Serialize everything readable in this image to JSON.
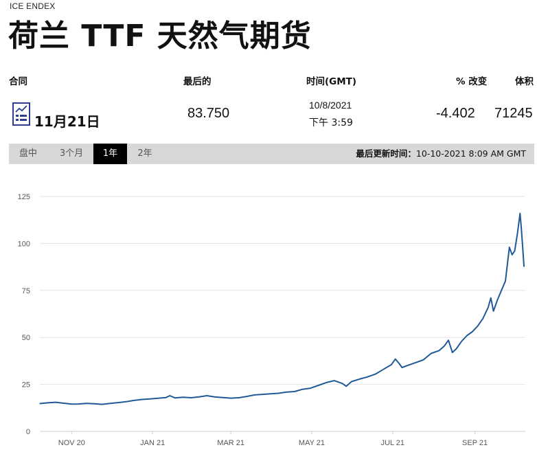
{
  "header": {
    "exchange": "ICE ENDEX",
    "title": "荷兰 TTF 天然气期货"
  },
  "quote_table": {
    "col_contract": "合同",
    "col_last": "最后的",
    "col_time": "时间(GMT)",
    "col_change": "% 改变",
    "col_volume": "体积",
    "contract_icon": "document-chart-icon",
    "contract": "11月21日",
    "last": "83.750",
    "date": "10/8/2021",
    "time": "下午 3:59",
    "change": "-4.402",
    "volume": "71245"
  },
  "tabs": [
    {
      "label": "盘中",
      "active": false
    },
    {
      "label": "3个月",
      "active": false
    },
    {
      "label": "1年",
      "active": true
    },
    {
      "label": "2年",
      "active": false
    }
  ],
  "last_updated_label": "最后更新时间：",
  "last_updated_value": "10-10-2021 8:09 AM GMT",
  "colors": {
    "line": "#1f5a96",
    "grid": "#e3e3e3",
    "tabbar": "#d8d8d8",
    "active_tab": "#000000"
  },
  "chart_data": {
    "type": "line",
    "ylim": [
      0,
      125
    ],
    "y_ticks": [
      0,
      25,
      50,
      75,
      100,
      125
    ],
    "x_tick_labels": [
      "NOV 20",
      "JAN 21",
      "MAR 21",
      "MAY 21",
      "JUL 21",
      "SEP 21"
    ],
    "x_tick_dates": [
      "2020-11-01",
      "2021-01-01",
      "2021-03-01",
      "2021-05-01",
      "2021-07-01",
      "2021-09-01"
    ],
    "xlim": [
      "2020-10-08",
      "2021-10-09"
    ],
    "grid": true,
    "series": [
      {
        "x": [
          "2020-10-08",
          "2020-10-14",
          "2020-10-20",
          "2020-10-26",
          "2020-11-01",
          "2020-11-06",
          "2020-11-12",
          "2020-11-18",
          "2020-11-24",
          "2020-11-30",
          "2020-12-06",
          "2020-12-12",
          "2020-12-18",
          "2020-12-24",
          "2020-12-30",
          "2021-01-05",
          "2021-01-11",
          "2021-01-14",
          "2021-01-18",
          "2021-01-24",
          "2021-01-30",
          "2021-02-05",
          "2021-02-11",
          "2021-02-17",
          "2021-02-23",
          "2021-03-01",
          "2021-03-07",
          "2021-03-13",
          "2021-03-19",
          "2021-03-25",
          "2021-03-31",
          "2021-04-06",
          "2021-04-12",
          "2021-04-18",
          "2021-04-24",
          "2021-04-30",
          "2021-05-06",
          "2021-05-12",
          "2021-05-18",
          "2021-05-24",
          "2021-05-27",
          "2021-05-31",
          "2021-06-06",
          "2021-06-12",
          "2021-06-18",
          "2021-06-24",
          "2021-06-30",
          "2021-07-03",
          "2021-07-06",
          "2021-07-08",
          "2021-07-12",
          "2021-07-18",
          "2021-07-24",
          "2021-07-30",
          "2021-08-05",
          "2021-08-09",
          "2021-08-12",
          "2021-08-15",
          "2021-08-18",
          "2021-08-22",
          "2021-08-26",
          "2021-08-30",
          "2021-09-03",
          "2021-09-07",
          "2021-09-11",
          "2021-09-13",
          "2021-09-15",
          "2021-09-18",
          "2021-09-21",
          "2021-09-24",
          "2021-09-27",
          "2021-09-29",
          "2021-10-01",
          "2021-10-03",
          "2021-10-05",
          "2021-10-06",
          "2021-10-08"
        ],
        "y": [
          14.8,
          15.2,
          15.5,
          15.0,
          14.5,
          14.6,
          14.9,
          14.7,
          14.4,
          14.9,
          15.3,
          15.8,
          16.5,
          17.0,
          17.3,
          17.6,
          18.0,
          19.0,
          17.8,
          18.2,
          17.9,
          18.4,
          19.0,
          18.3,
          18.0,
          17.7,
          17.9,
          18.6,
          19.4,
          19.7,
          20.0,
          20.3,
          20.9,
          21.2,
          22.4,
          23.0,
          24.5,
          26.0,
          27.0,
          25.5,
          24.0,
          26.5,
          27.8,
          29.0,
          30.5,
          33.0,
          35.5,
          38.5,
          36.0,
          34.0,
          35.0,
          36.5,
          38.0,
          41.5,
          43.0,
          45.5,
          48.5,
          42.0,
          44.0,
          48.0,
          51.0,
          53.0,
          56.0,
          60.0,
          66.0,
          71.0,
          64.0,
          70.0,
          75.0,
          80.0,
          98.0,
          94.0,
          96.0,
          105.0,
          116.0,
          108.0,
          87.7
        ]
      }
    ]
  }
}
